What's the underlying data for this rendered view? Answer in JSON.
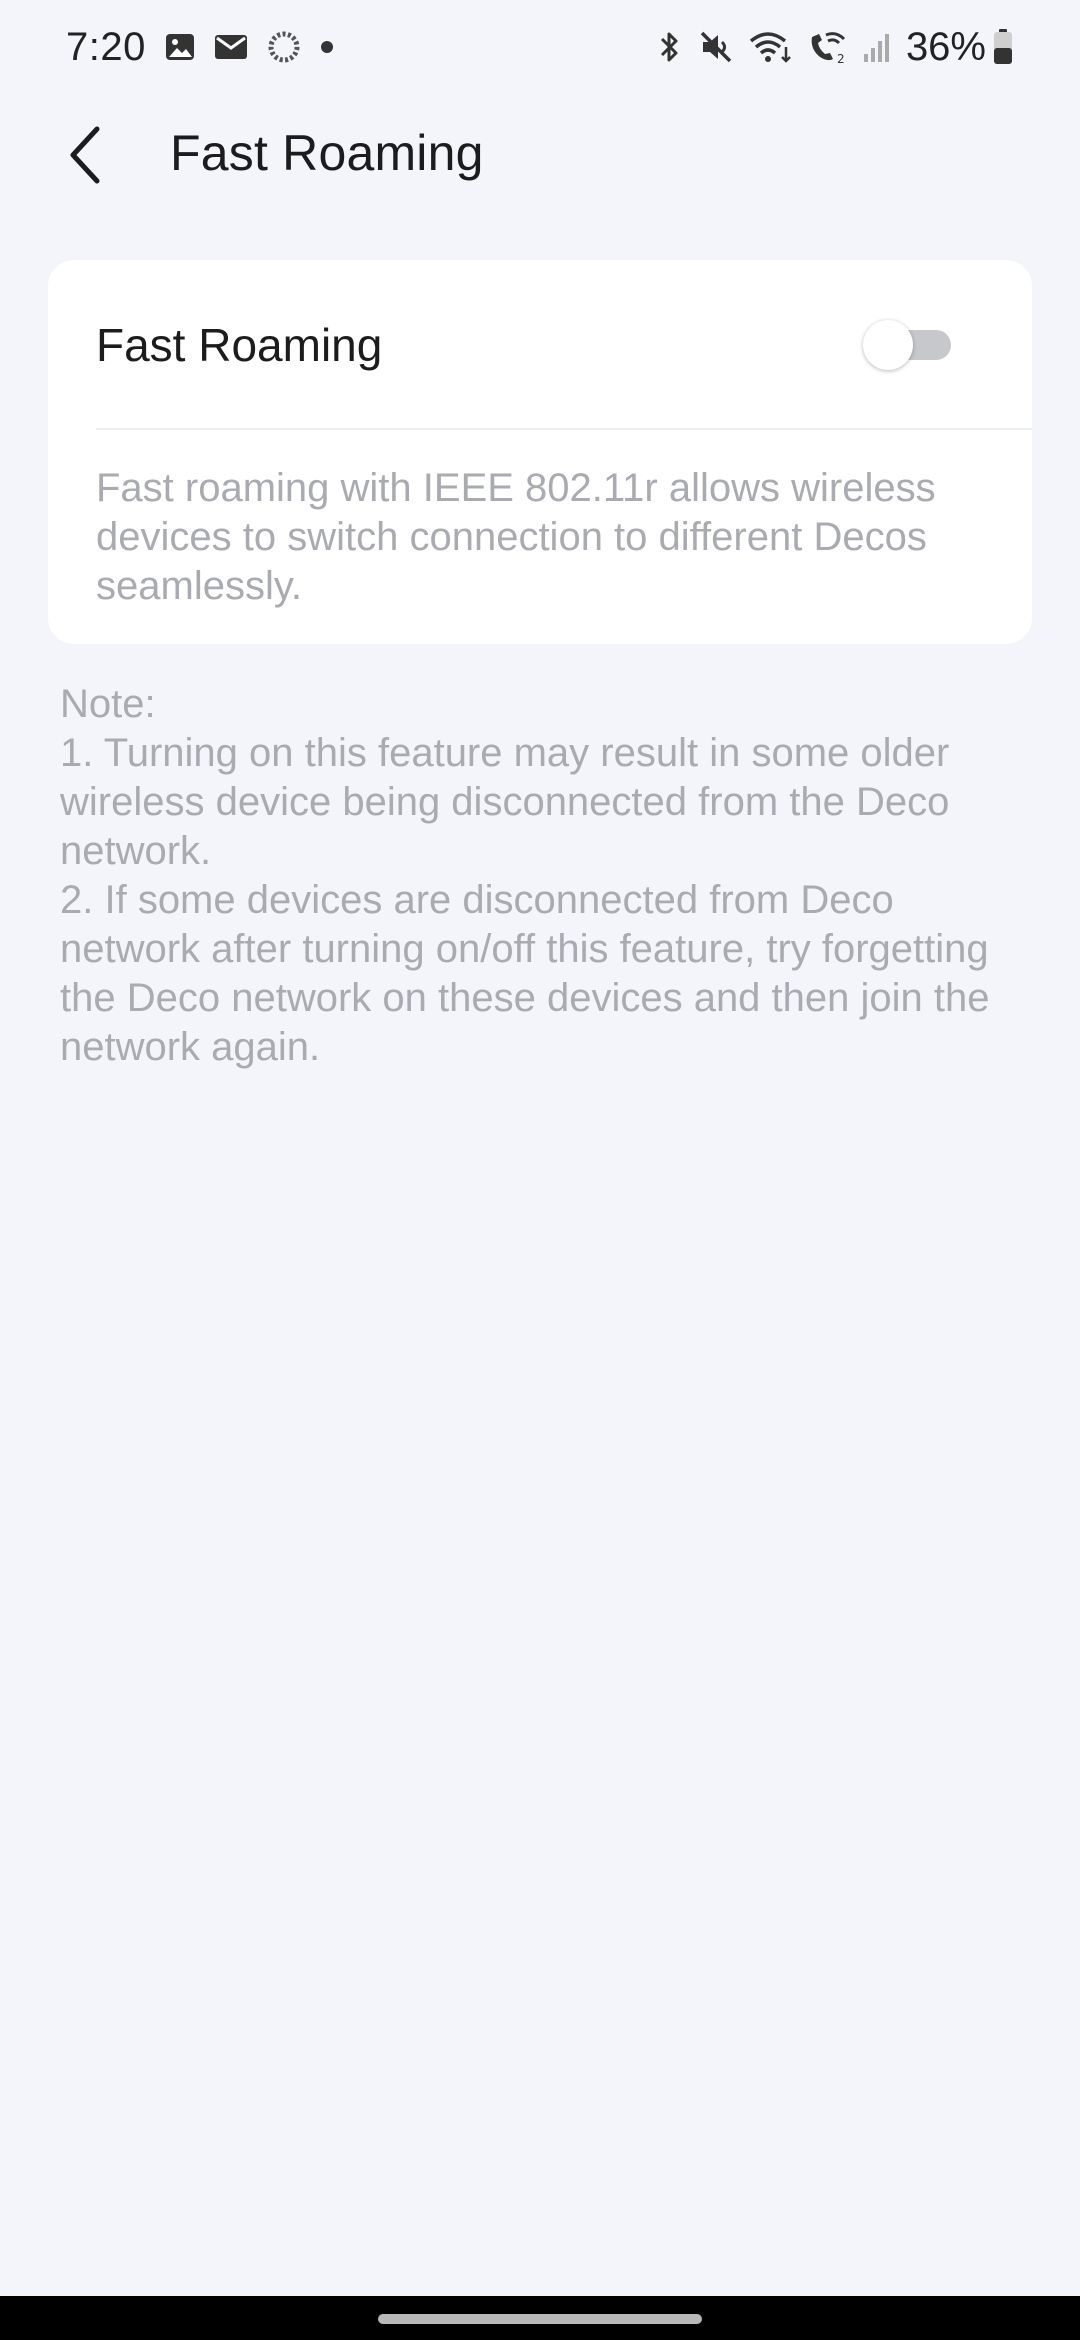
{
  "status_bar": {
    "time": "7:20",
    "left_icons": [
      "gallery-icon",
      "mail-icon",
      "sync-icon",
      "dot-icon"
    ],
    "right_icons": [
      "bluetooth-icon",
      "mute-icon",
      "wifi-icon",
      "wifi-calling-icon",
      "signal-icon"
    ],
    "battery_percent": "36%"
  },
  "header": {
    "title": "Fast Roaming",
    "back_icon": "chevron-left-icon"
  },
  "card": {
    "setting_label": "Fast Roaming",
    "toggle_state": "off",
    "description": "Fast roaming with IEEE 802.11r allows wireless devices to switch connection to different Decos seamlessly."
  },
  "note": {
    "heading": "Note:",
    "item_1": "1. Turning on this feature may result in some older wireless device being disconnected from the Deco network.",
    "item_2": "2. If some devices are disconnected from Deco network after turning on/off this feature, try forgetting the Deco network on these devices and then join the network again."
  },
  "colors": {
    "background": "#f4f5fa",
    "card": "#ffffff",
    "secondary_text": "#a9abb1",
    "toggle_off_track": "#c7c8cc"
  }
}
